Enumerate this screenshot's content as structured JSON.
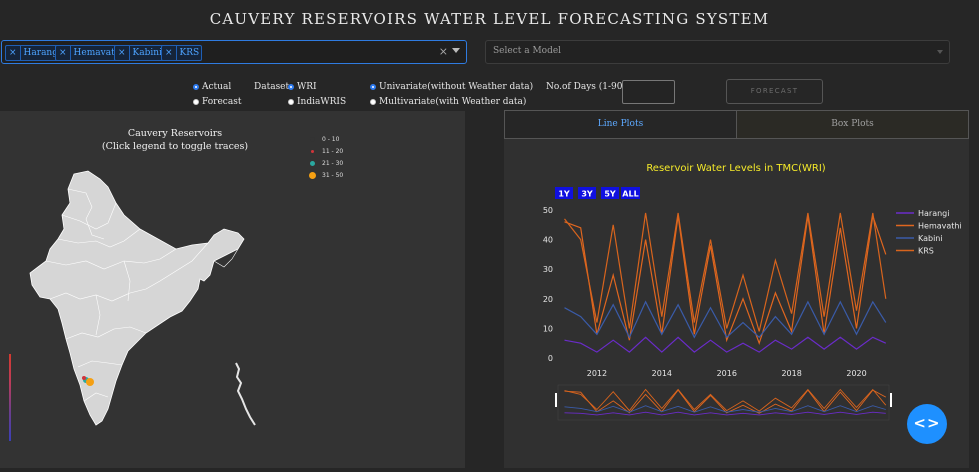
{
  "app": {
    "title": "CAUVERY RESERVOIRS WATER LEVEL FORECASTING SYSTEM"
  },
  "reservoir_select": {
    "selected": [
      "Harangi",
      "Hemavathi",
      "Kabini",
      "KRS"
    ],
    "remove_glyph": "×",
    "clear_glyph": "×"
  },
  "model_select": {
    "placeholder": "Select a Model"
  },
  "mode_radio": {
    "options": [
      "Actual",
      "Forecast"
    ],
    "selected": "Actual"
  },
  "dataset": {
    "label": "Dataset:",
    "options": [
      "WRI",
      "IndiaWRIS"
    ],
    "selected": "WRI"
  },
  "variate_radio": {
    "options": [
      "Univariate(without Weather data)",
      "Multivariate(with Weather data)"
    ],
    "selected": "Univariate(without Weather data)"
  },
  "days": {
    "label": "No.of Days (1-90):",
    "value": ""
  },
  "forecast_button": {
    "label": "FORECAST"
  },
  "map": {
    "title_line1": "Cauvery Reservoirs",
    "title_line2": "(Click legend to toggle traces)",
    "legend": [
      {
        "label": "0 - 10",
        "color": "#333333"
      },
      {
        "label": "11 - 20",
        "color": "#d0343a"
      },
      {
        "label": "21 - 30",
        "color": "#2aa8a0"
      },
      {
        "label": "31 - 50",
        "color": "#f5a013"
      }
    ]
  },
  "tabs": {
    "line": "Line Plots",
    "box": "Box Plots",
    "active": "Line Plots"
  },
  "fab": {
    "icon": "code-icon",
    "glyph": "<>"
  },
  "chart_data": {
    "type": "line",
    "title": "Reservoir Water Levels in TMC(WRI)",
    "range_buttons": [
      "1Y",
      "3Y",
      "5Y",
      "ALL"
    ],
    "x": [
      2011.0,
      2011.5,
      2012.0,
      2012.5,
      2013.0,
      2013.5,
      2014.0,
      2014.5,
      2015.0,
      2015.5,
      2016.0,
      2016.5,
      2017.0,
      2017.5,
      2018.0,
      2018.5,
      2019.0,
      2019.5,
      2020.0,
      2020.5,
      2020.9
    ],
    "xticks": [
      "2012",
      "2014",
      "2016",
      "2018",
      "2020"
    ],
    "xtick_values": [
      2012,
      2014,
      2016,
      2018,
      2020
    ],
    "xlim": [
      2010.8,
      2021.0
    ],
    "ylim": [
      0,
      50
    ],
    "yticks": [
      0,
      10,
      20,
      30,
      40,
      50
    ],
    "series": [
      {
        "name": "Harangi",
        "color": "#6a2cc9",
        "values": [
          6,
          5,
          2,
          6,
          2,
          7,
          2,
          7,
          2,
          6,
          2,
          5,
          2,
          6,
          3,
          7,
          3,
          7,
          3,
          7,
          5
        ]
      },
      {
        "name": "Hemavathi",
        "color": "#e0661f",
        "values": [
          46,
          44,
          8,
          28,
          6,
          40,
          8,
          48,
          8,
          38,
          6,
          20,
          5,
          22,
          9,
          48,
          8,
          44,
          10,
          48,
          35
        ]
      },
      {
        "name": "Kabini",
        "color": "#3a5ba8",
        "values": [
          17,
          14,
          8,
          18,
          7,
          19,
          8,
          18,
          7,
          17,
          7,
          12,
          7,
          14,
          8,
          19,
          8,
          19,
          8,
          19,
          12
        ]
      },
      {
        "name": "KRS",
        "color": "#d8641d",
        "values": [
          47,
          40,
          12,
          45,
          10,
          49,
          14,
          49,
          12,
          40,
          10,
          28,
          9,
          33,
          15,
          49,
          14,
          49,
          16,
          49,
          20
        ]
      }
    ]
  }
}
